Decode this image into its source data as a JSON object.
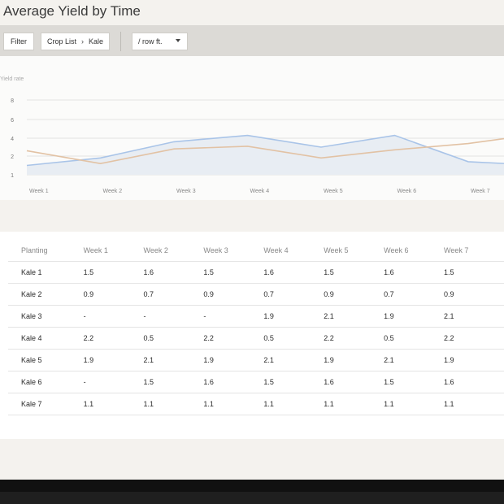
{
  "page": {
    "title": "Average Yield by Time"
  },
  "toolbar": {
    "filter_label": "Filter",
    "breadcrumb": [
      "Crop List",
      "Kale"
    ],
    "unit_select": {
      "selected": "/ row ft."
    }
  },
  "chart_data": {
    "type": "area",
    "ylabel": "Yield rate",
    "yticks": [
      1,
      2,
      4,
      6,
      8
    ],
    "ylim": [
      1,
      8
    ],
    "categories": [
      "Week 1",
      "Week 2",
      "Week 3",
      "Week 4",
      "Week 5",
      "Week 6",
      "Week 7"
    ],
    "grid": true,
    "series": [
      {
        "values": [
          1.5,
          1.9,
          3.6,
          4.3,
          3.0,
          4.3,
          1.7,
          1.5
        ],
        "color": "#a9c4e8",
        "fill": "#e8edf3"
      },
      {
        "values": [
          2.6,
          1.6,
          2.8,
          3.1,
          1.9,
          2.7,
          3.4,
          4.5
        ],
        "color": "#e2c2a4"
      }
    ]
  },
  "table": {
    "headers": [
      "Planting",
      "Week 1",
      "Week 2",
      "Week 3",
      "Week 4",
      "Week 5",
      "Week 6",
      "Week 7"
    ],
    "rows": [
      [
        "Kale 1",
        "1.5",
        "1.6",
        "1.5",
        "1.6",
        "1.5",
        "1.6",
        "1.5"
      ],
      [
        "Kale 2",
        "0.9",
        "0.7",
        "0.9",
        "0.7",
        "0.9",
        "0.7",
        "0.9"
      ],
      [
        "Kale 3",
        "-",
        "-",
        "-",
        "1.9",
        "2.1",
        "1.9",
        "2.1"
      ],
      [
        "Kale 4",
        "2.2",
        "0.5",
        "2.2",
        "0.5",
        "2.2",
        "0.5",
        "2.2"
      ],
      [
        "Kale 5",
        "1.9",
        "2.1",
        "1.9",
        "2.1",
        "1.9",
        "2.1",
        "1.9"
      ],
      [
        "Kale 6",
        "-",
        "1.5",
        "1.6",
        "1.5",
        "1.6",
        "1.5",
        "1.6"
      ],
      [
        "Kale 7",
        "1.1",
        "1.1",
        "1.1",
        "1.1",
        "1.1",
        "1.1",
        "1.1"
      ]
    ]
  }
}
